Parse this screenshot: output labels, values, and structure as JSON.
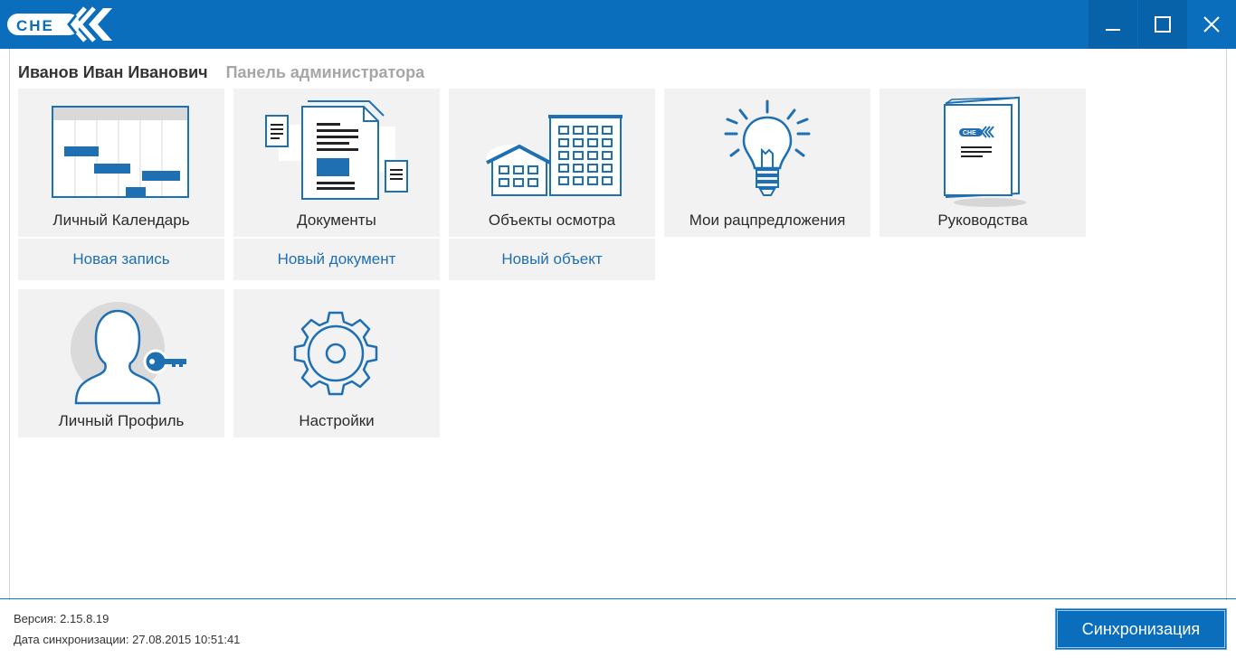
{
  "app": {
    "logo_text": "CHE",
    "colors": {
      "brand": "#0a6ebd",
      "link": "#1f6fb3",
      "tile_bg": "#f2f2f2"
    }
  },
  "window_controls": {
    "minimize": "minimize-icon",
    "maximize": "maximize-icon",
    "close": "close-icon"
  },
  "header": {
    "user_name": "Иванов Иван Иванович",
    "admin_panel": "Панель администратора"
  },
  "tiles": [
    {
      "label": "Личный Календарь",
      "icon": "calendar-gantt-icon",
      "action": "Новая запись"
    },
    {
      "label": "Документы",
      "icon": "documents-icon",
      "action": "Новый документ"
    },
    {
      "label": "Объекты осмотра",
      "icon": "buildings-icon",
      "action": "Новый объект"
    },
    {
      "label": "Мои рацпредложения",
      "icon": "lightbulb-icon"
    },
    {
      "label": "Руководства",
      "icon": "manual-book-icon"
    },
    {
      "label": "Личный Профиль",
      "icon": "user-key-icon"
    },
    {
      "label": "Настройки",
      "icon": "gear-icon"
    }
  ],
  "footer": {
    "version": "Версия: 2.15.8.19",
    "sync_date": "Дата синхронизации: 27.08.2015 10:51:41",
    "sync_button": "Синхронизация"
  }
}
